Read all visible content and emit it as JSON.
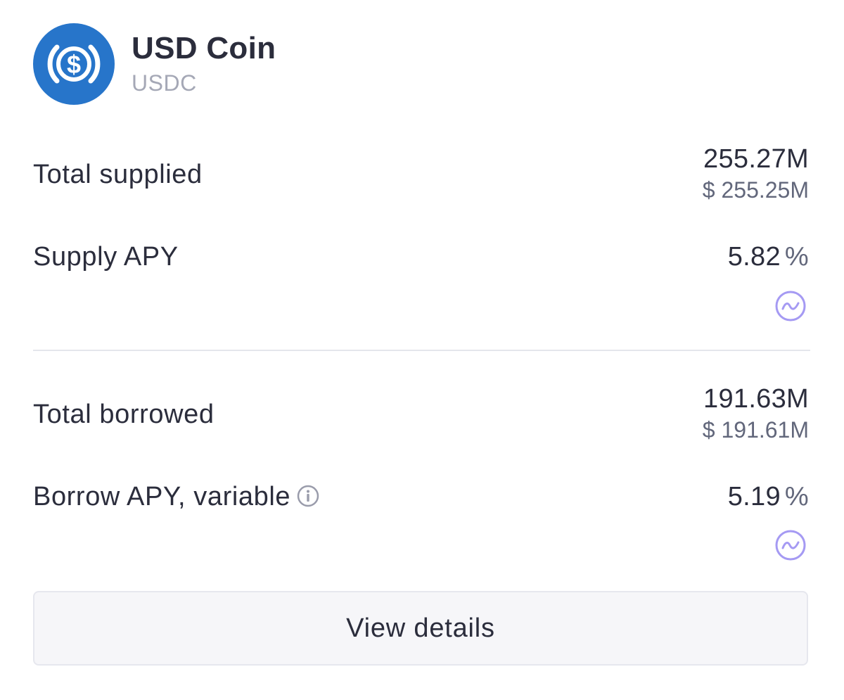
{
  "asset": {
    "name": "USD Coin",
    "symbol": "USDC",
    "logo_icon": "usdc-logo-icon",
    "logo_color": "#2775ca"
  },
  "supply": {
    "total_label": "Total supplied",
    "total_value": "255.27M",
    "total_usd": "$ 255.25M",
    "apy_label": "Supply APY",
    "apy_value": "5.82",
    "apy_unit": "%",
    "incentive_icon": "incentive-chart-icon"
  },
  "borrow": {
    "total_label": "Total borrowed",
    "total_value": "191.63M",
    "total_usd": "$ 191.61M",
    "apy_label": "Borrow APY, variable",
    "apy_value": "5.19",
    "apy_unit": "%",
    "info_icon": "info-icon",
    "incentive_icon": "incentive-chart-icon"
  },
  "actions": {
    "view_details_label": "View details"
  },
  "colors": {
    "accent_purple": "#a59af3",
    "text_primary": "#2b2d3c",
    "text_secondary": "#62677b",
    "text_muted": "#a5a8b6"
  }
}
